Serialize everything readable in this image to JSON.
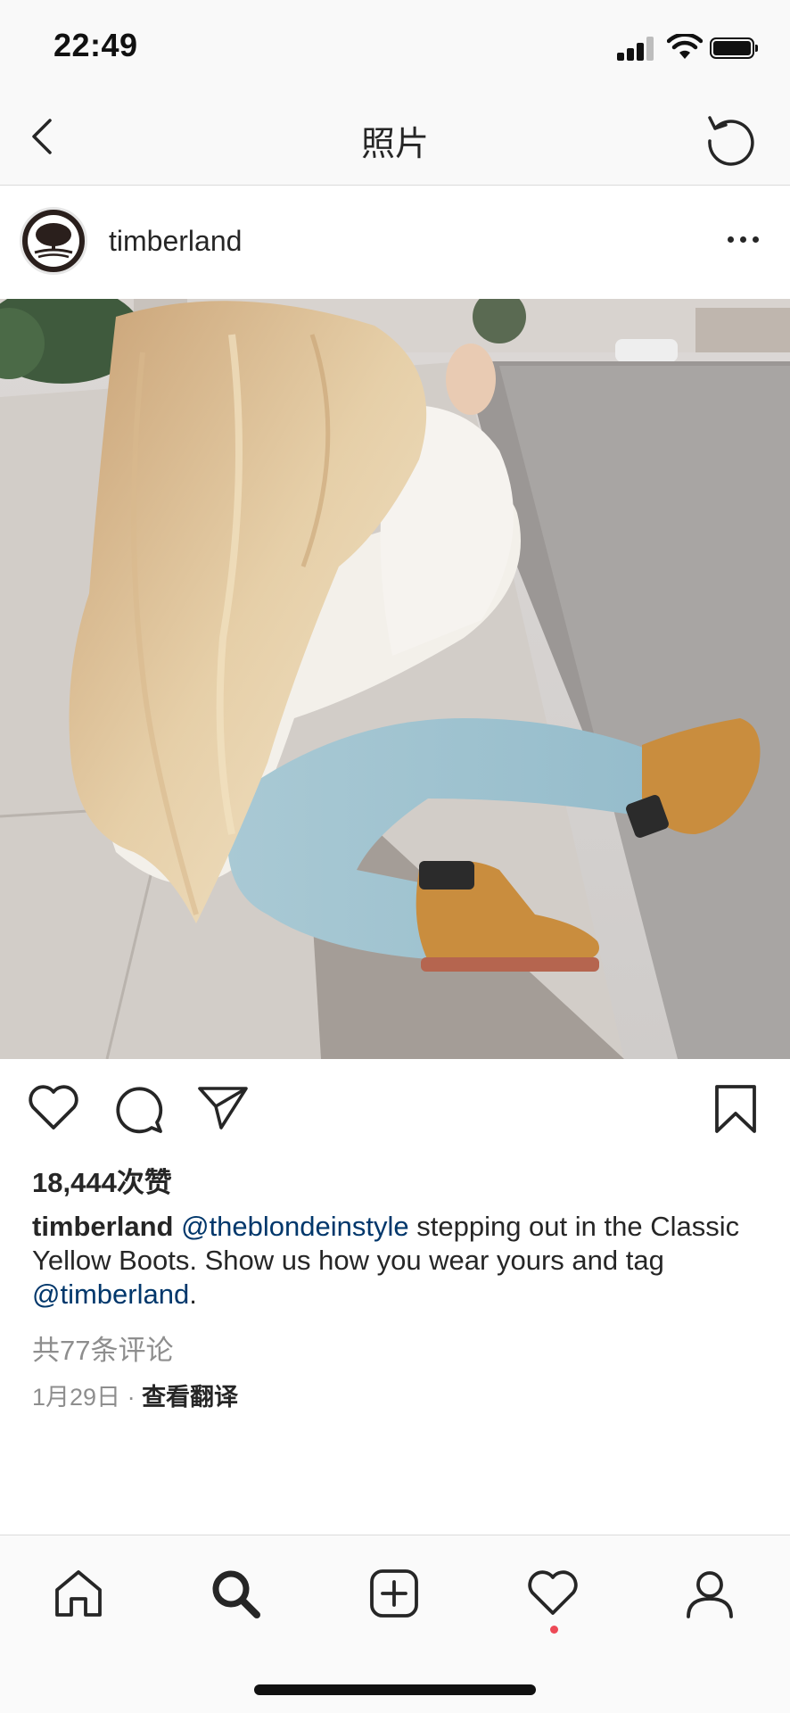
{
  "status_bar": {
    "time": "22:49"
  },
  "header": {
    "title": "照片"
  },
  "post": {
    "username": "timberland",
    "likes": "18,444次赞",
    "caption": {
      "user": "timberland",
      "mention1": "@theblondeinstyle",
      "text1": " stepping out in the Classic Yellow Boots. Show us how you wear yours and tag ",
      "mention2": "@timberland",
      "text2": "."
    },
    "comments_link": "共77条评论",
    "date": "1月29日",
    "separator": " · ",
    "translate_label": "查看翻译"
  },
  "icons": {
    "back": "chevron-left-icon",
    "refresh": "refresh-icon",
    "more": "more-horizontal-icon",
    "like": "heart-icon",
    "comment": "comment-bubble-icon",
    "share": "paper-plane-icon",
    "save": "bookmark-icon",
    "tabs": [
      "home-icon",
      "search-icon",
      "add-post-icon",
      "activity-heart-icon",
      "profile-icon"
    ]
  },
  "colors": {
    "mention": "#00376b",
    "secondary_text": "#8e8e8e",
    "notification_dot": "#ed4956"
  }
}
